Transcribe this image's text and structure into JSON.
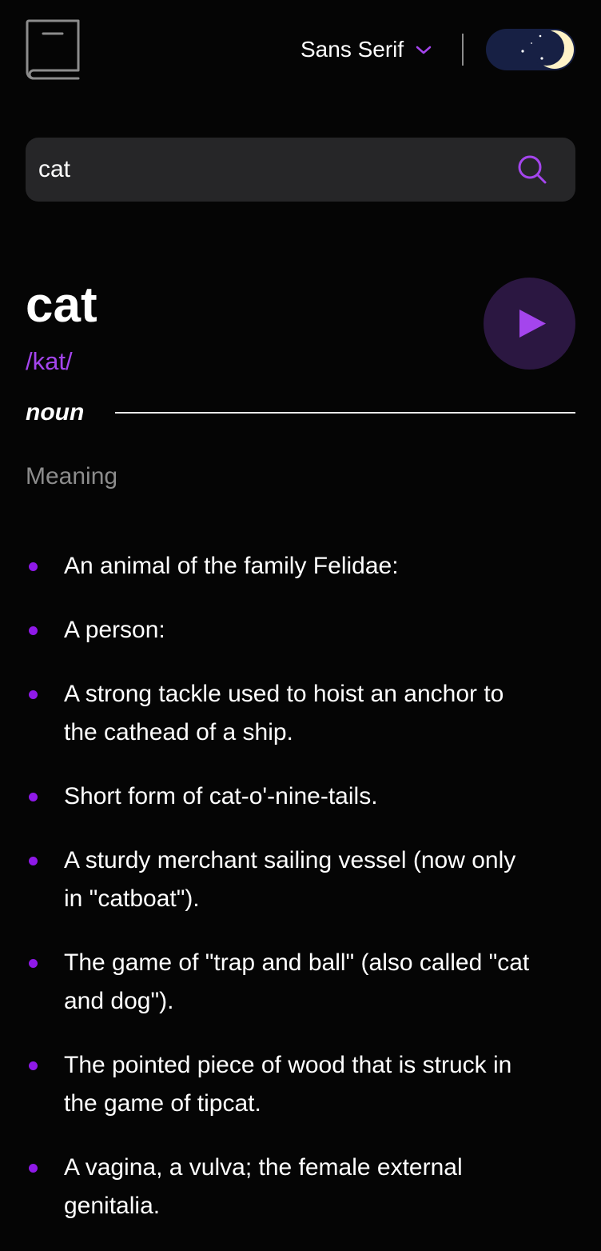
{
  "header": {
    "logo_icon": "book-icon",
    "font_selector": {
      "selected": "Sans Serif",
      "icon": "chevron-down-icon"
    },
    "theme_toggle": {
      "icon": "moon-icon",
      "state": "dark"
    }
  },
  "search": {
    "value": "cat",
    "icon": "search-icon"
  },
  "entry": {
    "word": "cat",
    "phonetic": "/kat/",
    "play_icon": "play-icon",
    "part_of_speech": "noun",
    "meaning_heading": "Meaning",
    "definitions": [
      "An animal of the family Felidae:",
      "A person:",
      "A strong tackle used to hoist an anchor to the cathead of a ship.",
      "Short form of cat-o'-nine-tails.",
      "A sturdy merchant sailing vessel (now only in \"catboat\").",
      "The game of \"trap and ball\" (also called \"cat and dog\").",
      "The pointed piece of wood that is struck in the game of tipcat.",
      "A vagina, a vulva; the female external genitalia."
    ]
  },
  "colors": {
    "background": "#050505",
    "accent": "#a445ed",
    "bullet": "#8f19e8",
    "search_background": "#262628",
    "muted_text": "#8c8c8c",
    "play_button": "#2b1741",
    "toggle_background": "#172044"
  }
}
